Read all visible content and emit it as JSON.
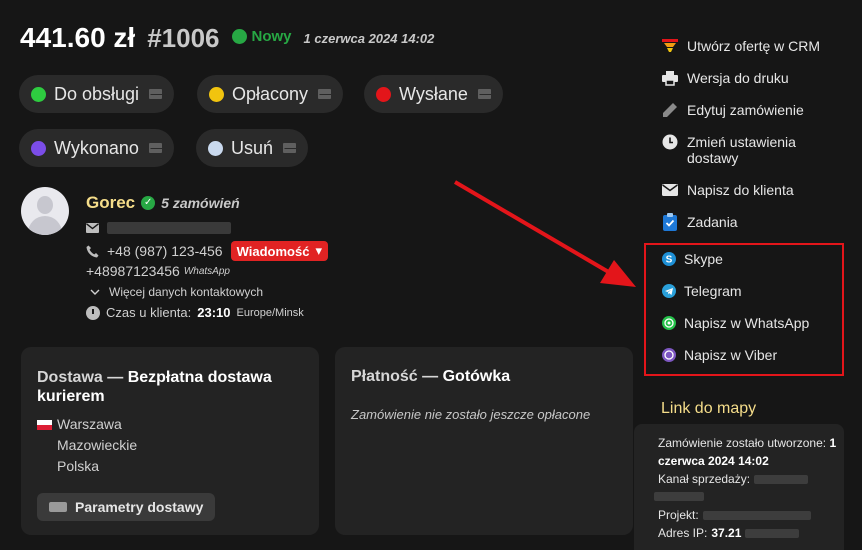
{
  "header": {
    "amount": "441.60 zł",
    "order_number": "#1006",
    "status": "Nowy",
    "date": "1 czerwca 2024 14:02"
  },
  "status_buttons": [
    {
      "label": "Do obsługi",
      "color": "#2ecc40"
    },
    {
      "label": "Opłacony",
      "color": "#f1c40f"
    },
    {
      "label": "Wysłane",
      "color": "#e3151a"
    },
    {
      "label": "Wykonano",
      "color": "#7b4de8"
    },
    {
      "label": "Usuń",
      "color": "#c9d9ee"
    }
  ],
  "customer": {
    "name": "Gorec",
    "orders": "5 zamówień",
    "phone": "+48 (987) 123-456",
    "message_badge": "Wiadomość",
    "whatsapp_number": "+48987123456",
    "whatsapp_label": "WhatsApp",
    "more_contacts": "Więcej danych kontaktowych",
    "time_label": "Czas u klienta:",
    "time_value": "23:10",
    "timezone": "Europe/Minsk"
  },
  "delivery": {
    "title_prefix": "Dostawa —",
    "title_value": "Bezpłatna dostawa kurierem",
    "city": "Warszawa",
    "region": "Mazowieckie",
    "country": "Polska",
    "params_button": "Parametry dostawy"
  },
  "payment": {
    "title_prefix": "Płatność —",
    "title_value": "Gotówka",
    "status_text": "Zamówienie nie zostało jeszcze opłacone"
  },
  "sidebar": {
    "actions": [
      {
        "label": "Utwórz ofertę w CRM",
        "icon": "funnel-icon"
      },
      {
        "label": "Wersja do druku",
        "icon": "printer-icon"
      },
      {
        "label": "Edytuj zamówienie",
        "icon": "pencil-icon"
      },
      {
        "label": "Zmień ustawienia\ndostawy",
        "icon": "clock-icon"
      },
      {
        "label": "Napisz do klienta",
        "icon": "envelope-icon"
      },
      {
        "label": "Zadania",
        "icon": "clipboard-icon"
      }
    ],
    "messengers": [
      {
        "label": "Skype",
        "icon": "skype-icon",
        "color": "#1e90d6"
      },
      {
        "label": "Telegram",
        "icon": "telegram-icon",
        "color": "#2aa0da"
      },
      {
        "label": "Napisz w WhatsApp",
        "icon": "whatsapp-icon",
        "color": "#25c14a"
      },
      {
        "label": "Napisz w Viber",
        "icon": "viber-icon",
        "color": "#7d57c1"
      }
    ],
    "map_link": "Link do mapy",
    "created_label": "Zamówienie zostało utworzone:",
    "created_value_1": "1",
    "created_value_2": "czerwca 2024 14:02",
    "channel_label": "Kanał sprzedaży:",
    "project_label": "Projekt:",
    "ip_label": "Adres IP:",
    "ip_value": "37.21"
  }
}
